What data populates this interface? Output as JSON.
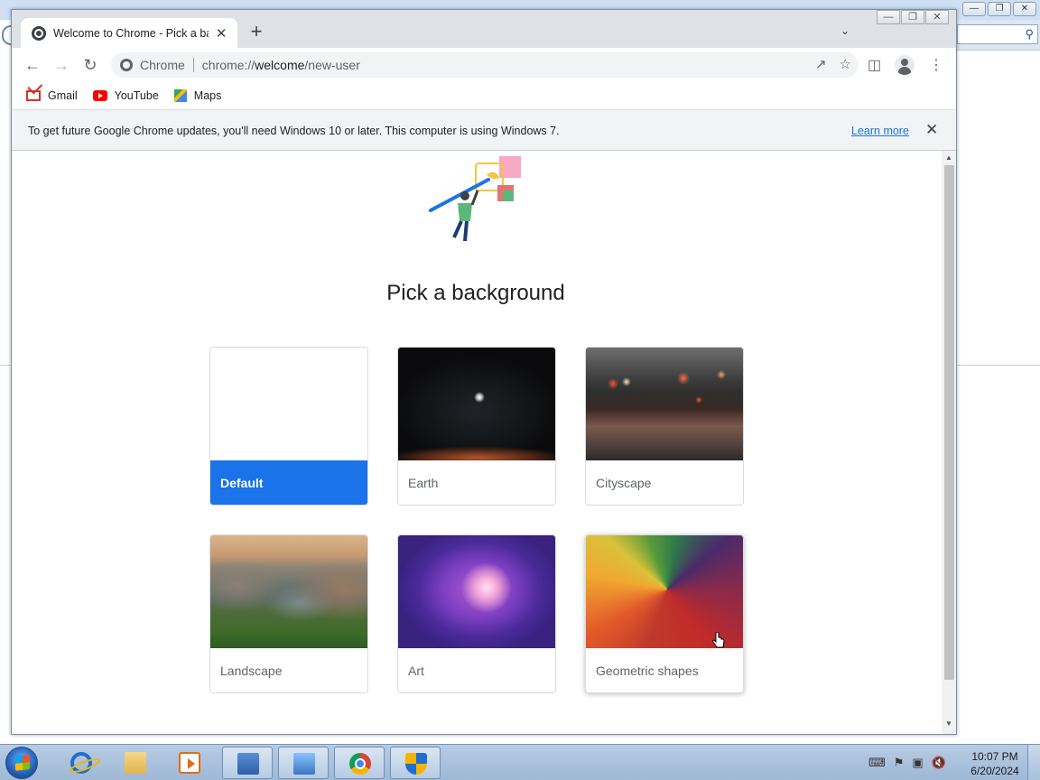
{
  "browser": {
    "tab_title": "Welcome to Chrome - Pick a background",
    "omnibox_chip": "Chrome",
    "url_prefix": "chrome://",
    "url_host": "welcome",
    "url_path": "/new-user"
  },
  "bookmarks": [
    {
      "label": "Gmail"
    },
    {
      "label": "YouTube"
    },
    {
      "label": "Maps"
    }
  ],
  "infobar": {
    "message": "To get future Google Chrome updates, you'll need Windows 10 or later. This computer is using Windows 7.",
    "link": "Learn more"
  },
  "page": {
    "title": "Pick a background",
    "cards": [
      {
        "label": "Default",
        "selected": true
      },
      {
        "label": "Earth",
        "selected": false
      },
      {
        "label": "Cityscape",
        "selected": false
      },
      {
        "label": "Landscape",
        "selected": false
      },
      {
        "label": "Art",
        "selected": false
      },
      {
        "label": "Geometric shapes",
        "selected": false,
        "hovered": true
      }
    ]
  },
  "taskbar": {
    "time": "10:07 PM",
    "date": "6/20/2024"
  },
  "colors": {
    "accent": "#1a73e8",
    "tabstrip": "#dee1e6",
    "infobar": "#f1f3f4"
  }
}
